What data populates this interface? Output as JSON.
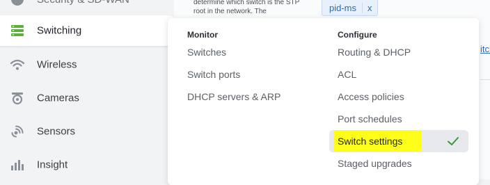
{
  "sidebar": {
    "items": [
      {
        "label": "Security & SD-WAN",
        "icon": "shield-icon"
      },
      {
        "label": "Switching",
        "icon": "switch-icon",
        "active": true
      },
      {
        "label": "Wireless",
        "icon": "wifi-icon"
      },
      {
        "label": "Cameras",
        "icon": "camera-icon"
      },
      {
        "label": "Sensors",
        "icon": "sensor-icon"
      },
      {
        "label": "Insight",
        "icon": "bar-chart-icon"
      }
    ]
  },
  "background": {
    "description": "determine which switch is the STP root in the network. The",
    "tag_text": "pid-ms",
    "tag_remove": "x",
    "link_fragment": "itch"
  },
  "menu": {
    "monitor": {
      "heading": "Monitor",
      "items": [
        "Switches",
        "Switch ports",
        "DHCP servers & ARP"
      ]
    },
    "configure": {
      "heading": "Configure",
      "items": [
        "Routing & DHCP",
        "ACL",
        "Access policies",
        "Port schedules",
        "Switch settings",
        "Staged upgrades"
      ],
      "selected": "Switch settings"
    }
  },
  "colors": {
    "highlight": "#ffff1a",
    "check": "#3a9a3a",
    "accent": "#2b6cb0"
  }
}
